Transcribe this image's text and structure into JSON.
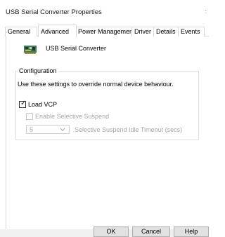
{
  "window": {
    "title": "USB Serial Converter Properties",
    "close_glyph": ":"
  },
  "tabs": [
    {
      "label": "General",
      "active": false
    },
    {
      "label": "Advanced",
      "active": true
    },
    {
      "label": "Power Management",
      "active": false
    },
    {
      "label": "Driver",
      "active": false
    },
    {
      "label": "Details",
      "active": false
    },
    {
      "label": "Events",
      "active": false
    }
  ],
  "device": {
    "name": "USB Serial Converter",
    "icon": "circuit-board-icon"
  },
  "configuration": {
    "legend": "Configuration",
    "description": "Use these settings to override normal device behaviour.",
    "load_vcp": {
      "label": "Load VCP",
      "checked": true,
      "enabled": true
    },
    "selective_suspend": {
      "label": "Enable Selective Suspend",
      "checked": false,
      "enabled": false
    },
    "idle_timeout": {
      "value": "5",
      "label": "Selective Suspend Idle Timeout (secs)",
      "enabled": false
    }
  },
  "buttons": {
    "ok": "OK",
    "cancel": "Cancel",
    "help": "Help"
  },
  "colors": {
    "border": "#d9d9d9",
    "disabled_text": "#a7a7a7",
    "button_face": "#e1e1e1"
  }
}
